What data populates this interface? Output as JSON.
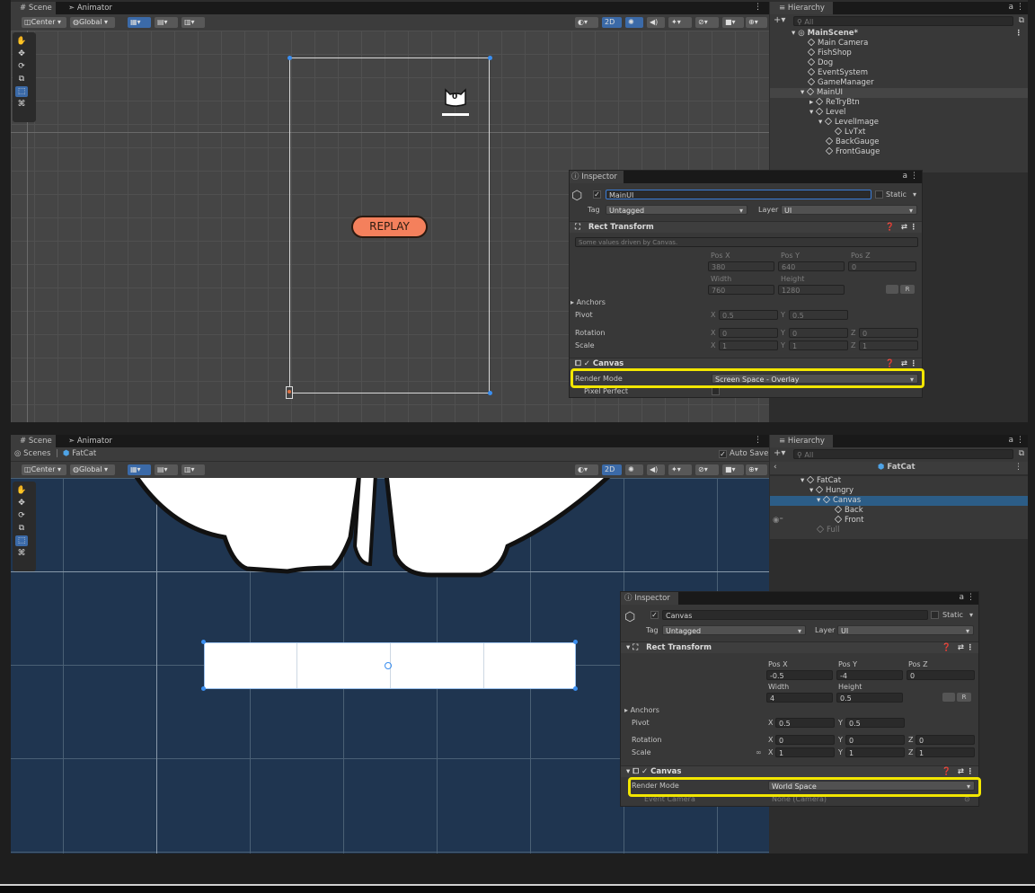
{
  "top": {
    "tabs": {
      "scene": "Scene",
      "animator": "Animator"
    },
    "toolbar": {
      "center": "Center",
      "global": "Global",
      "two_d": "2D"
    },
    "scene": {
      "replay_label": "REPLAY",
      "cat_score": "0"
    },
    "hierarchy": {
      "title": "Hierarchy",
      "search_placeholder": "All",
      "items": [
        {
          "label": "MainScene*"
        },
        {
          "label": "Main Camera"
        },
        {
          "label": "FishShop"
        },
        {
          "label": "Dog"
        },
        {
          "label": "EventSystem"
        },
        {
          "label": "GameManager"
        },
        {
          "label": "MainUI"
        },
        {
          "label": "ReTryBtn"
        },
        {
          "label": "Level"
        },
        {
          "label": "LevelImage"
        },
        {
          "label": "LvTxt"
        },
        {
          "label": "BackGauge"
        },
        {
          "label": "FrontGauge"
        }
      ]
    },
    "inspector": {
      "title": "Inspector",
      "object_name": "MainUI",
      "static_label": "Static",
      "tag_label": "Tag",
      "tag_value": "Untagged",
      "layer_label": "Layer",
      "layer_value": "UI",
      "rect_transform": "Rect Transform",
      "driven_note": "Some values driven by Canvas.",
      "posx_label": "Pos X",
      "posy_label": "Pos Y",
      "posz_label": "Pos Z",
      "posx": "380",
      "posy": "640",
      "posz": "0",
      "width_label": "Width",
      "height_label": "Height",
      "width": "760",
      "height": "1280",
      "anchors": "Anchors",
      "pivot": "Pivot",
      "pivot_x": "0.5",
      "pivot_y": "0.5",
      "rotation": "Rotation",
      "rot_x": "0",
      "rot_y": "0",
      "rot_z": "0",
      "scale": "Scale",
      "scale_x": "1",
      "scale_y": "1",
      "scale_z": "1",
      "canvas": "Canvas",
      "render_mode_label": "Render Mode",
      "render_mode_value": "Screen Space - Overlay",
      "pixel_perfect": "Pixel Perfect"
    }
  },
  "bottom": {
    "tabs": {
      "scene": "Scene",
      "animator": "Animator"
    },
    "breadcrumb": {
      "scenes": "Scenes",
      "prefab": "FatCat"
    },
    "auto_save": "Auto Save",
    "toolbar": {
      "center": "Center",
      "global": "Global",
      "two_d": "2D"
    },
    "hierarchy": {
      "title": "Hierarchy",
      "search_placeholder": "All",
      "prefab_title": "FatCat",
      "items": [
        {
          "label": "FatCat"
        },
        {
          "label": "Hungry"
        },
        {
          "label": "Canvas"
        },
        {
          "label": "Back"
        },
        {
          "label": "Front"
        },
        {
          "label": "Full"
        }
      ]
    },
    "inspector": {
      "title": "Inspector",
      "object_name": "Canvas",
      "static_label": "Static",
      "tag_label": "Tag",
      "tag_value": "Untagged",
      "layer_label": "Layer",
      "layer_value": "UI",
      "rect_transform": "Rect Transform",
      "posx_label": "Pos X",
      "posy_label": "Pos Y",
      "posz_label": "Pos Z",
      "posx": "-0.5",
      "posy": "-4",
      "posz": "0",
      "width_label": "Width",
      "height_label": "Height",
      "width": "4",
      "height": "0.5",
      "anchors": "Anchors",
      "pivot": "Pivot",
      "pivot_x": "0.5",
      "pivot_y": "0.5",
      "rotation": "Rotation",
      "rot_x": "0",
      "rot_y": "0",
      "rot_z": "0",
      "scale": "Scale",
      "scale_x": "1",
      "scale_y": "1",
      "scale_z": "1",
      "canvas": "Canvas",
      "render_mode_label": "Render Mode",
      "render_mode_value": "World Space",
      "event_camera_label": "Event Camera",
      "event_camera_value": "None (Camera)"
    }
  },
  "axis_labels": {
    "x": "X",
    "y": "Y",
    "z": "Z",
    "r": "R"
  },
  "colors": {
    "highlight": "#f2e600",
    "selection": "#2c5d87",
    "replay_button": "#f4805c",
    "world_bg": "#1f3550"
  }
}
